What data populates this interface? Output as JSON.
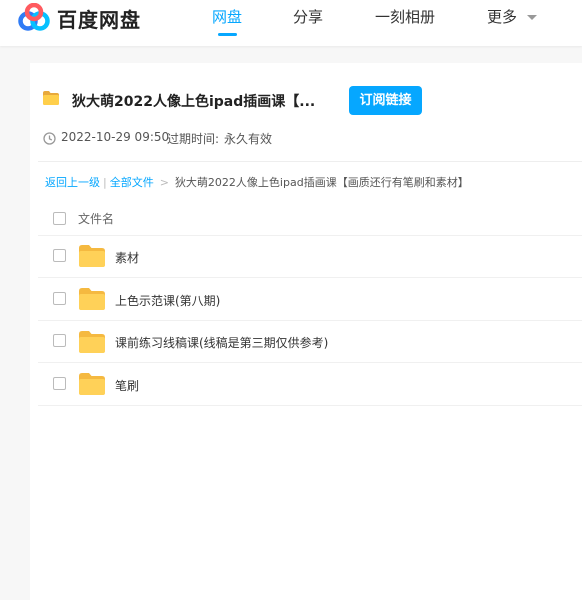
{
  "header": {
    "logo_text": "百度网盘",
    "nav": [
      {
        "label": "网盘",
        "active": true
      },
      {
        "label": "分享",
        "active": false
      },
      {
        "label": "一刻相册",
        "active": false
      },
      {
        "label": "更多",
        "active": false
      }
    ]
  },
  "share": {
    "title": "狄大萌2022人像上色ipad插画课【...",
    "subscribe_button": "订阅链接",
    "date": "2022-10-29 09:50",
    "expire_label": "过期时间:",
    "expire_value": "永久有效"
  },
  "breadcrumb": {
    "back": "返回上一级",
    "all_files": "全部文件",
    "current": "狄大萌2022人像上色ipad插画课【画质还行有笔刷和素材】"
  },
  "file_list": {
    "column_header": "文件名",
    "items": [
      {
        "name": "素材",
        "icon": "folder-icon"
      },
      {
        "name": "上色示范课(第八期)",
        "icon": "folder-icon"
      },
      {
        "name": "课前练习线稿课(线稿是第三期仅供参考)",
        "icon": "folder-icon"
      },
      {
        "name": "笔刷",
        "icon": "folder-icon"
      }
    ]
  },
  "colors": {
    "accent": "#06a7ff",
    "folder": "#ffcf4b"
  }
}
